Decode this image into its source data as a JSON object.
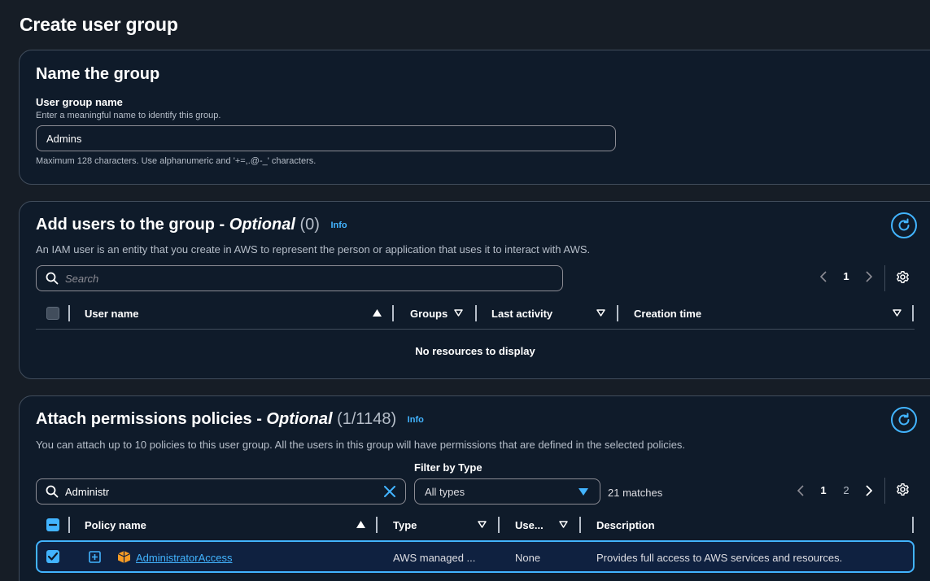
{
  "page_title": "Create user group",
  "name_section": {
    "heading": "Name the group",
    "field_label": "User group name",
    "field_description": "Enter a meaningful name to identify this group.",
    "field_value": "Admins",
    "constraint": "Maximum 128 characters. Use alphanumeric and '+=,.@-_' characters."
  },
  "users_section": {
    "heading": "Add users to the group - ",
    "optional": "Optional",
    "count": "(0)",
    "info": "Info",
    "description": "An IAM user is an entity that you create in AWS to represent the person or application that uses it to interact with AWS.",
    "search_placeholder": "Search",
    "current_page": "1",
    "columns": [
      "User name",
      "Groups",
      "Last activity",
      "Creation time"
    ],
    "empty_message": "No resources to display"
  },
  "policies_section": {
    "heading": "Attach permissions policies - ",
    "optional": "Optional",
    "count": "(1/1148)",
    "info": "Info",
    "description": "You can attach up to 10 policies to this user group. All the users in this group will have permissions that are defined in the selected policies.",
    "search_value": "Administr",
    "filter_label": "Filter by Type",
    "filter_value": "All types",
    "matches": "21 matches",
    "pages": [
      "1",
      "2"
    ],
    "columns": [
      "Policy name",
      "Type",
      "Use...",
      "Description"
    ],
    "rows": [
      {
        "name": "AdministratorAccess",
        "type": "AWS managed ...",
        "used_as": "None",
        "description": "Provides full access to AWS services and resources."
      }
    ]
  },
  "colors": {
    "accent": "#42b4ff",
    "background": "#161d26",
    "card": "#0f1b2a",
    "border": "#414d5c",
    "aws_orange": "#f89c24"
  },
  "icons": [
    "search-icon",
    "refresh-icon",
    "settings-icon",
    "chevron-left-icon",
    "chevron-right-icon",
    "sort-asc-icon",
    "sort-desc-icon",
    "clear-icon",
    "caret-down-icon",
    "expand-icon",
    "aws-policy-icon",
    "checkbox-checked-icon"
  ]
}
